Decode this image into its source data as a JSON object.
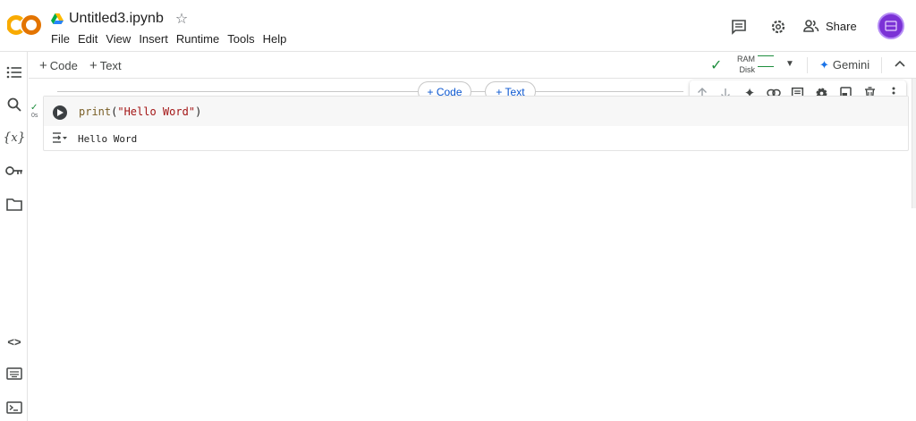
{
  "header": {
    "logo_text": "CO",
    "title": "Untitled3.ipynb",
    "menu": [
      "File",
      "Edit",
      "View",
      "Insert",
      "Runtime",
      "Tools",
      "Help"
    ],
    "share_label": "Share",
    "icons": [
      "comment-icon",
      "settings-icon",
      "share-people-icon",
      "avatar"
    ]
  },
  "rail": {
    "icons": [
      "table-of-contents-icon",
      "search-icon",
      "variables-icon",
      "secrets-key-icon",
      "folder-icon",
      "code-snippets-icon",
      "command-palette-icon",
      "terminal-icon"
    ]
  },
  "toolbar": {
    "add_code": "Code",
    "add_text": "Text",
    "ram_label": "RAM",
    "disk_label": "Disk",
    "gemini_label": "Gemini"
  },
  "insert": {
    "code_label": "+ Code",
    "text_label": "+ Text"
  },
  "cell": {
    "exec_time": "0s",
    "code": {
      "fn": "print",
      "open": "(",
      "str": "\"Hello Word\"",
      "close": ")"
    },
    "output": "Hello Word"
  },
  "cell_toolbar": {
    "icons": [
      "move-up-icon",
      "move-down-icon",
      "gemini-spark-icon",
      "link-icon",
      "comment-icon",
      "settings-icon",
      "mirror-cell-icon",
      "delete-icon",
      "more-icon"
    ]
  },
  "colors": {
    "accent_blue": "#0b57d0",
    "success_green": "#1e8e3e",
    "logo_orange": "#f9ab00",
    "logo_dark_orange": "#e37400",
    "avatar_purple": "#7b32d6"
  }
}
